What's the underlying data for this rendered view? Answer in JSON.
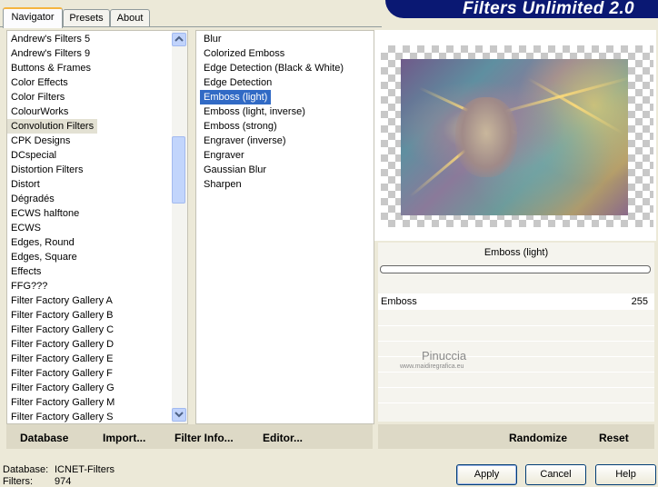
{
  "tabs": [
    {
      "label": "Navigator",
      "active": true
    },
    {
      "label": "Presets",
      "active": false
    },
    {
      "label": "About",
      "active": false
    }
  ],
  "app_title": "Filters Unlimited 2.0",
  "categories": {
    "items": [
      "Andrew's Filters 5",
      "Andrew's Filters 9",
      "Buttons & Frames",
      "Color Effects",
      "Color Filters",
      "ColourWorks",
      "Convolution Filters",
      "CPK Designs",
      "DCspecial",
      "Distortion Filters",
      "Distort",
      "Dégradés",
      "ECWS halftone",
      "ECWS",
      "Edges, Round",
      "Edges, Square",
      "Effects",
      "FFG???",
      "Filter Factory Gallery A",
      "Filter Factory Gallery B",
      "Filter Factory Gallery C",
      "Filter Factory Gallery D",
      "Filter Factory Gallery E",
      "Filter Factory Gallery F",
      "Filter Factory Gallery G",
      "Filter Factory Gallery M",
      "Filter Factory Gallery S"
    ],
    "selected_index": 6
  },
  "filters": {
    "items": [
      "Blur",
      "Colorized Emboss",
      "Edge Detection (Black & White)",
      "Edge Detection",
      "Emboss (light)",
      "Emboss (light, inverse)",
      "Emboss (strong)",
      "Engraver (inverse)",
      "Engraver",
      "Gaussian Blur",
      "Sharpen"
    ],
    "selected_index": 4
  },
  "filter_name": "Emboss (light)",
  "parameter": {
    "label": "Emboss",
    "value": "255"
  },
  "watermark": {
    "name": "Pinuccia",
    "url": "www.maidiregrafica.eu"
  },
  "left_toolbar": {
    "database": "Database",
    "import": "Import...",
    "filter_info": "Filter Info...",
    "editor": "Editor..."
  },
  "right_toolbar": {
    "randomize": "Randomize",
    "reset": "Reset"
  },
  "status": {
    "database_label": "Database:",
    "database_value": "ICNET-Filters",
    "filters_label": "Filters:",
    "filters_value": "974"
  },
  "buttons": {
    "apply": "Apply",
    "cancel": "Cancel",
    "help": "Help"
  },
  "colors": {
    "banner": "#0a1873",
    "selection": "#316ac5",
    "accent_tab": "#f5b53f"
  },
  "icons": {
    "scroll_up": "chevron-up-icon",
    "scroll_down": "chevron-down-icon"
  }
}
